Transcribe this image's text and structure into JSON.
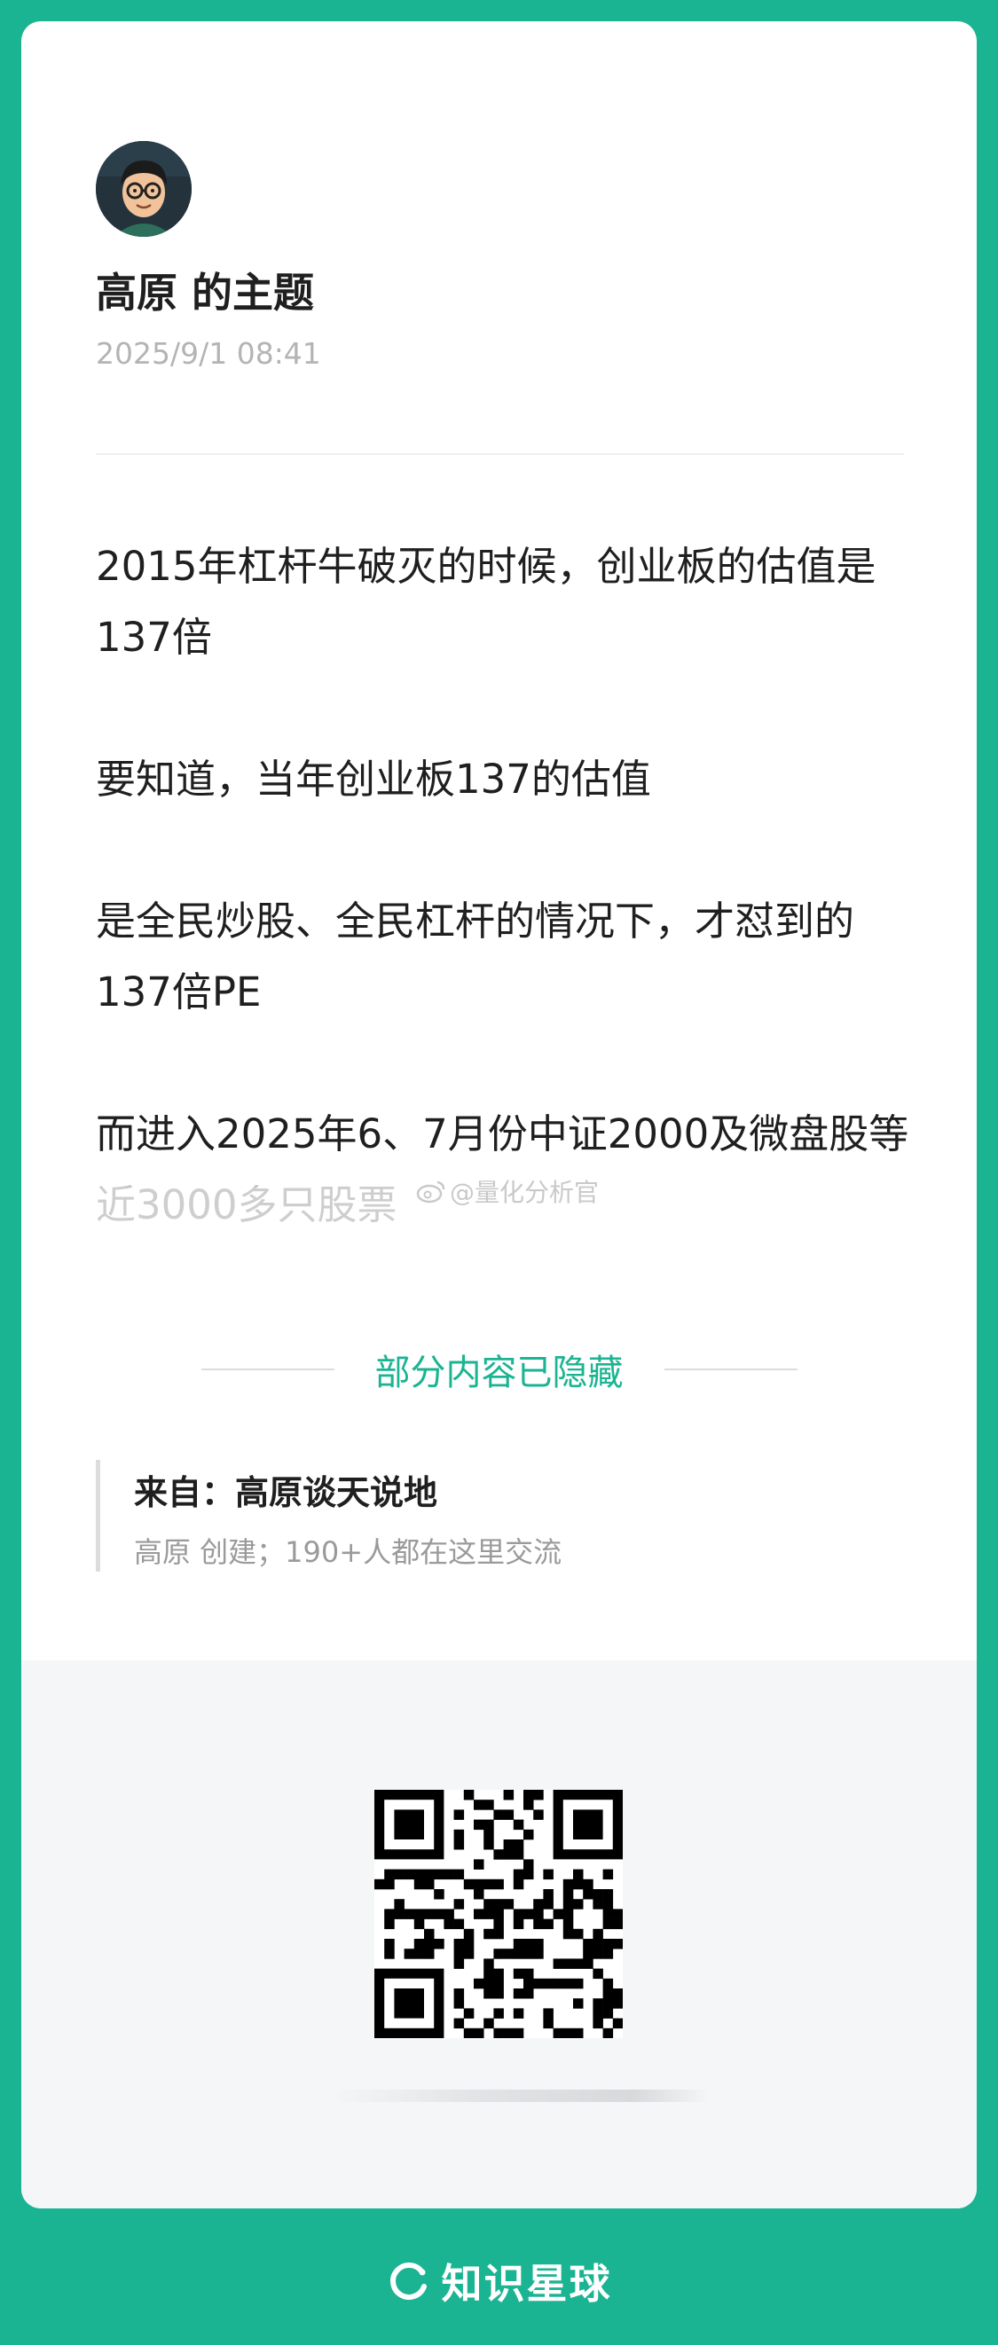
{
  "post": {
    "author_title": "高原 的主题",
    "time": "2025/9/1 08:41",
    "paragraphs": [
      "2015年杠杆牛破灭的时候，创业板的估值是137倍",
      "要知道，当年创业板137的估值",
      "是全民炒股、全民杠杆的情况下，才怼到的137倍PE",
      "而进入2025年6、7月份中证2000及微盘股等近3000多只股票"
    ]
  },
  "watermark": {
    "text": "@量化分析官",
    "icon": "weibo-icon"
  },
  "hidden_notice": "部分内容已隐藏",
  "source": {
    "title": "来自：高原谈天说地",
    "subtitle": "高原 创建；190+人都在这里交流"
  },
  "footer": {
    "brand": "知识星球",
    "icon": "planet-ring-icon"
  },
  "colors": {
    "brand_green": "#1bb492",
    "text": "#1f1f1f",
    "muted": "#b4b4b4"
  }
}
